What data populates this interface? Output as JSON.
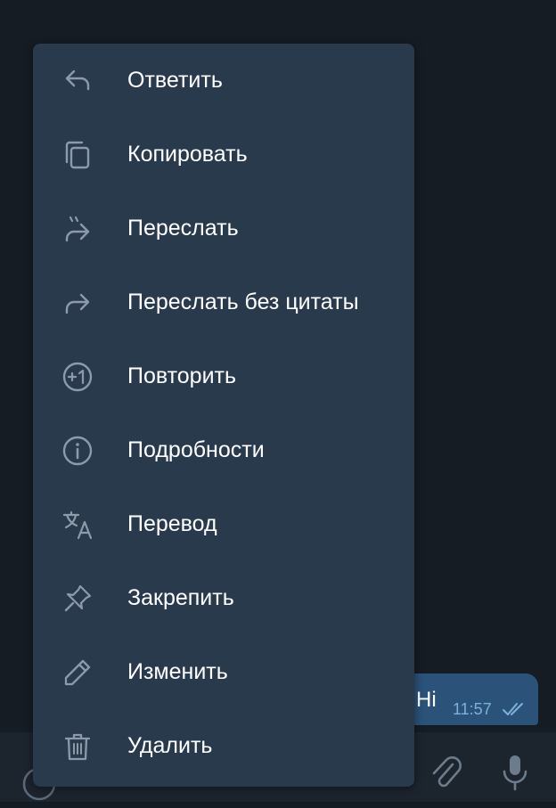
{
  "message": {
    "text": "Hi",
    "time": "11:57",
    "status_icon": "double-check-icon"
  },
  "context_menu": {
    "items": [
      {
        "label": "Ответить",
        "icon": "reply-icon"
      },
      {
        "label": "Копировать",
        "icon": "copy-icon"
      },
      {
        "label": "Переслать",
        "icon": "forward-icon"
      },
      {
        "label": "Переслать без цитаты",
        "icon": "forward-no-quote-icon"
      },
      {
        "label": "Повторить",
        "icon": "plus-one-icon"
      },
      {
        "label": "Подробности",
        "icon": "info-icon"
      },
      {
        "label": "Перевод",
        "icon": "translate-icon"
      },
      {
        "label": "Закрепить",
        "icon": "pin-icon"
      },
      {
        "label": "Изменить",
        "icon": "edit-icon"
      },
      {
        "label": "Удалить",
        "icon": "delete-icon"
      }
    ]
  },
  "input_bar": {
    "icons": [
      "emoji-icon",
      "attach-icon",
      "microphone-icon"
    ]
  },
  "colors": {
    "menu_background": "#2a3a4d",
    "chat_background": "#161c23",
    "bubble_background": "#2b5278",
    "icon_color": "#8c9aaa",
    "text_color": "#ffffff",
    "timestamp_color": "#7eb1dc"
  }
}
